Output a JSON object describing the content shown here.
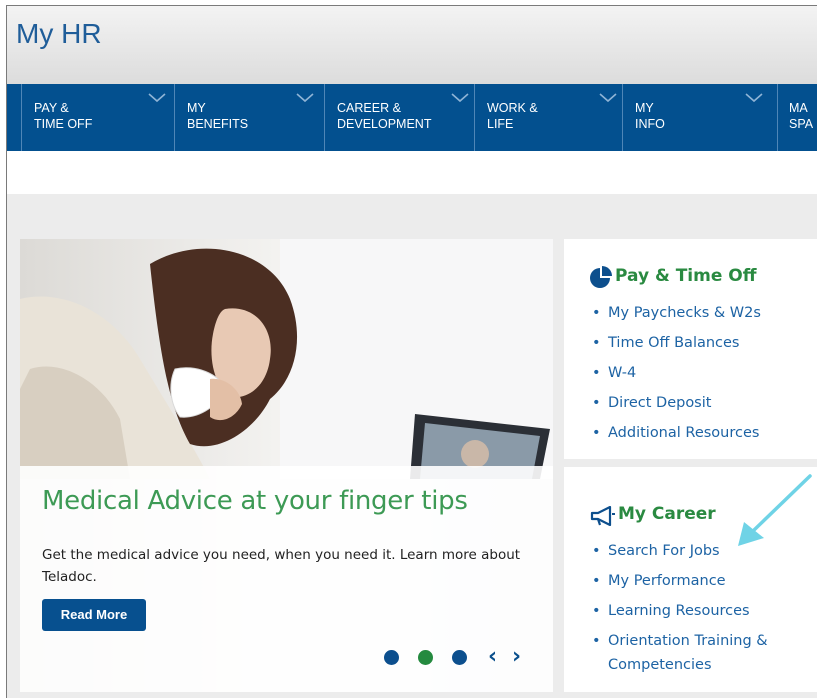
{
  "app": {
    "title": "My HR"
  },
  "nav": {
    "items": [
      {
        "label": "PAY &\nTIME OFF"
      },
      {
        "label": "MY\nBENEFITS"
      },
      {
        "label": "CAREER &\nDEVELOPMENT"
      },
      {
        "label": "WORK &\nLIFE"
      },
      {
        "label": "MY\nINFO"
      },
      {
        "label": "MA\nSPA"
      }
    ]
  },
  "hero": {
    "title": "Medical Advice at your finger tips",
    "body": "Get the medical advice you need, when you need it. Learn more about Teladoc.",
    "button_label": "Read More",
    "carousel": {
      "dots": 3,
      "active_dot": 2,
      "prev_label": "‹",
      "next_label": "›"
    }
  },
  "cards": {
    "pay": {
      "title": "Pay & Time Off",
      "icon": "pie-chart-icon",
      "links": [
        "My Paychecks & W2s",
        "Time Off Balances",
        "W-4",
        "Direct Deposit",
        "Additional Resources"
      ]
    },
    "career": {
      "title": "My Career",
      "icon": "megaphone-icon",
      "links": [
        "Search For Jobs",
        "My Performance",
        "Learning Resources",
        "Orientation Training & Competencies"
      ]
    }
  },
  "colors": {
    "brand_blue": "#03508f",
    "title_blue": "#1f5d99",
    "accent_green": "#2a8a41",
    "link_blue": "#1d63a4",
    "callout_cyan": "#6fd3e6"
  }
}
